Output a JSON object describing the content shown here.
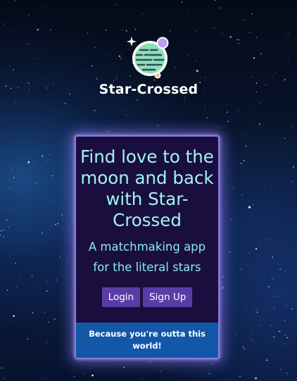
{
  "brand": {
    "name": "Star-Crossed"
  },
  "hero": {
    "headline": "Find love to the moon and back with Star-Crossed",
    "tagline": "A matchmaking app for the literal stars"
  },
  "actions": {
    "login_label": "Login",
    "signup_label": "Sign Up"
  },
  "footer": {
    "text": "Because you're outta this world!"
  },
  "colors": {
    "card_background": "#1a0e3f",
    "card_border_glow": "#8d7ae0",
    "headline_text": "#9ff5ef",
    "button_background": "#5a3ca6",
    "footer_background": "#1358a8",
    "planet": "#8ee0b7",
    "moon": "#b79ff0"
  },
  "icons": {
    "logo": "planet-icon",
    "sparkle": "sparkle-icon"
  }
}
